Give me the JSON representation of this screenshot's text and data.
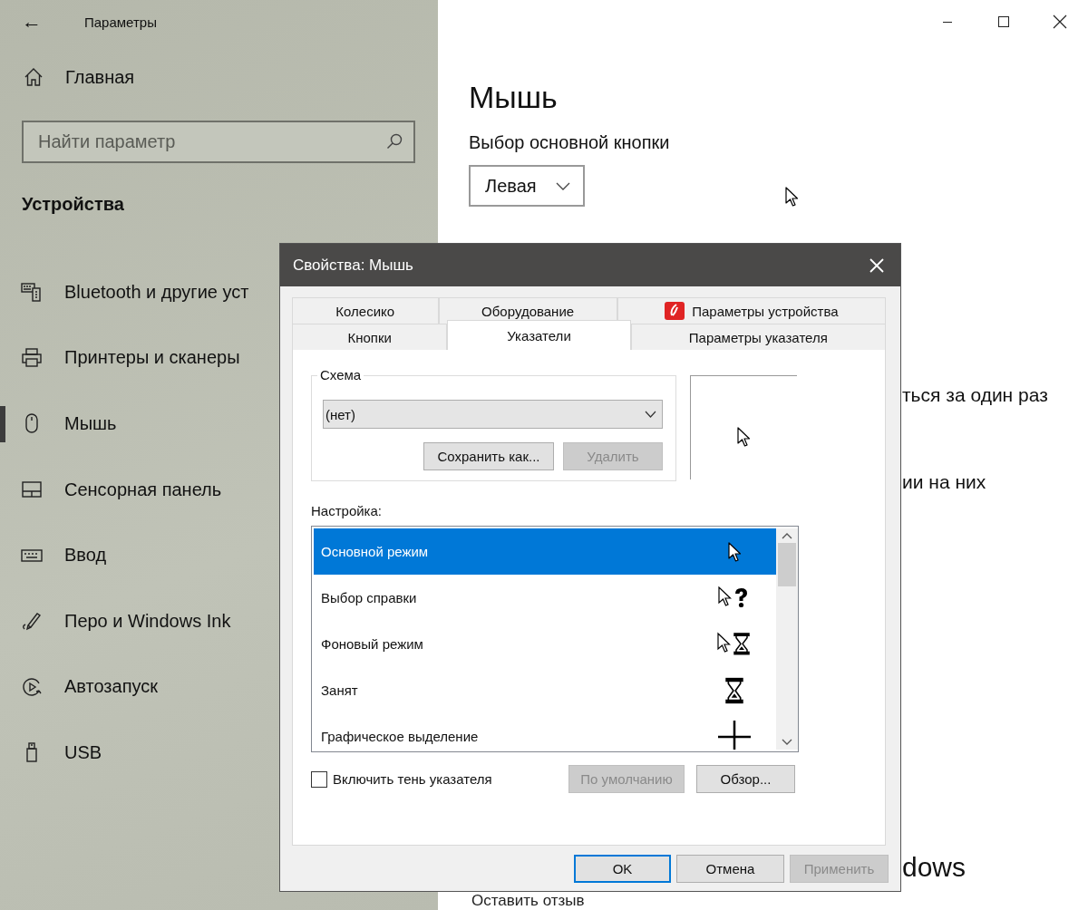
{
  "window": {
    "title": "Параметры",
    "back": "←"
  },
  "sidebar": {
    "home": "Главная",
    "search": {
      "placeholder": "Найти параметр"
    },
    "section": "Устройства",
    "items": [
      {
        "label": "Bluetooth и другие уст",
        "selected": false,
        "kind": "bluetooth"
      },
      {
        "label": "Принтеры и сканеры",
        "selected": false,
        "kind": "printer"
      },
      {
        "label": "Мышь",
        "selected": true,
        "kind": "mouse"
      },
      {
        "label": "Сенсорная панель",
        "selected": false,
        "kind": "touchpad"
      },
      {
        "label": "Ввод",
        "selected": false,
        "kind": "keyboard"
      },
      {
        "label": "Перо и Windows Ink",
        "selected": false,
        "kind": "pen"
      },
      {
        "label": "Автозапуск",
        "selected": false,
        "kind": "autoplay"
      },
      {
        "label": "USB",
        "selected": false,
        "kind": "usb"
      }
    ]
  },
  "page": {
    "title": "Мышь",
    "primary_button_label": "Выбор основной кнопки",
    "primary_button_value": "Левая",
    "hidden_line_1": "ться за один раз",
    "hidden_line_2": "ии на них",
    "hidden_heading": "dows",
    "feedback_link": "Оставить отзыв"
  },
  "dialog": {
    "title": "Свойства: Мышь",
    "tab_rows": [
      {
        "tabs": [
          {
            "label": "Колесико",
            "selected": false,
            "kind": "plain"
          },
          {
            "label": "Оборудование",
            "selected": false,
            "kind": "plain"
          },
          {
            "label": "Параметры устройства",
            "selected": false,
            "kind": "with-icon"
          }
        ]
      },
      {
        "tabs": [
          {
            "label": "Кнопки",
            "selected": false,
            "kind": "plain"
          },
          {
            "label": "Указатели",
            "selected": true,
            "kind": "plain"
          },
          {
            "label": "Параметры указателя",
            "selected": false,
            "kind": "plain"
          }
        ]
      }
    ],
    "scheme": {
      "label": "Схема",
      "value": "(нет)",
      "buttons": [
        {
          "label": "Сохранить как...",
          "disabled": false
        },
        {
          "label": "Удалить",
          "disabled": true
        }
      ]
    },
    "customize_label": "Настройка:",
    "cursors": [
      {
        "label": "Основной режим",
        "selected": true,
        "kind": "arrow"
      },
      {
        "label": "Выбор справки",
        "selected": false,
        "kind": "help"
      },
      {
        "label": "Фоновый режим",
        "selected": false,
        "kind": "working"
      },
      {
        "label": "Занят",
        "selected": false,
        "kind": "busy"
      },
      {
        "label": "Графическое выделение",
        "selected": false,
        "kind": "cross"
      }
    ],
    "shadow": {
      "label": "Включить тень указателя",
      "checked": false
    },
    "list_buttons": [
      {
        "label": "По умолчанию",
        "disabled": true
      },
      {
        "label": "Обзор...",
        "disabled": false
      }
    ],
    "buttons": [
      {
        "label": "OK",
        "disabled": false,
        "default": true
      },
      {
        "label": "Отмена",
        "disabled": false,
        "default": false
      },
      {
        "label": "Применить",
        "disabled": true,
        "default": false
      }
    ]
  }
}
